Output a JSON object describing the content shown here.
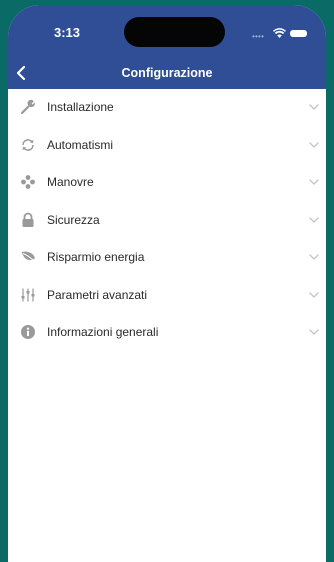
{
  "status_bar": {
    "time": "3:13"
  },
  "nav": {
    "title": "Configurazione"
  },
  "menu": {
    "items": [
      {
        "label": "Installazione",
        "icon": "wrench-icon"
      },
      {
        "label": "Automatismi",
        "icon": "refresh-icon"
      },
      {
        "label": "Manovre",
        "icon": "gamepad-icon"
      },
      {
        "label": "Sicurezza",
        "icon": "lock-icon"
      },
      {
        "label": "Risparmio energia",
        "icon": "leaf-icon"
      },
      {
        "label": "Parametri avanzati",
        "icon": "sliders-icon"
      },
      {
        "label": "Informazioni generali",
        "icon": "info-icon"
      }
    ]
  },
  "colors": {
    "background": "#0a6b66",
    "header": "#2f4e96",
    "icon": "#9a9a9a",
    "chevron": "#c4c4c4"
  }
}
